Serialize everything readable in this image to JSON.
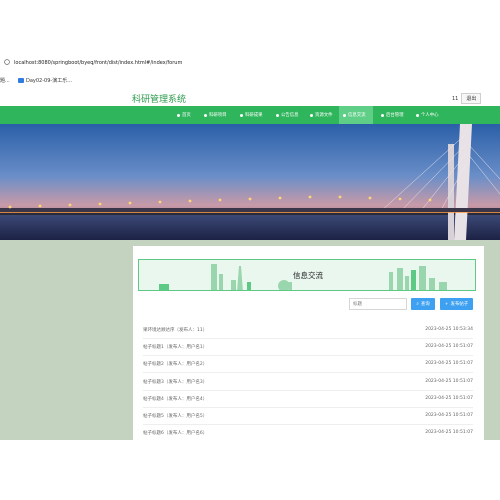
{
  "browser": {
    "url": "localhost:8080/springboot/byeq/front/dist/index.html#/index/forum",
    "bookmarks_left": "題...",
    "bookmark": "Day02-09-演工乐..."
  },
  "header": {
    "site_title": "科研管理系统",
    "user_count": "11",
    "exit_label": "退出"
  },
  "nav": {
    "items": [
      {
        "label": "首页"
      },
      {
        "label": "科研项目"
      },
      {
        "label": "科研成果"
      },
      {
        "label": "公告信息"
      },
      {
        "label": "资源文件"
      },
      {
        "label": "信息交流"
      },
      {
        "label": "后台管理"
      },
      {
        "label": "个人中心"
      }
    ],
    "active_index": 5
  },
  "forum": {
    "title": "信息交流",
    "search_placeholder": "标题",
    "search_label": "查询",
    "post_label": "发布帖子"
  },
  "posts": [
    {
      "title": "果环境达顾达序（发布人：11）",
      "date": "2023-04-25 10:53:34"
    },
    {
      "title": "帖子标题1（发布人：用户名1）",
      "date": "2023-04-25 10:51:07"
    },
    {
      "title": "帖子标题2（发布人：用户名2）",
      "date": "2023-04-25 10:51:07"
    },
    {
      "title": "帖子标题3（发布人：用户名3）",
      "date": "2023-04-25 10:51:07"
    },
    {
      "title": "帖子标题4（发布人：用户名4）",
      "date": "2023-04-25 10:51:07"
    },
    {
      "title": "帖子标题5（发布人：用户名5）",
      "date": "2023-04-25 10:51:07"
    },
    {
      "title": "帖子标题6（发布人：用户名6）",
      "date": "2023-04-25 10:51:07"
    }
  ],
  "colors": {
    "brand_green": "#2fb55b",
    "nav_active": "#5fcf88",
    "title_green": "#2a9a4c",
    "button_blue": "#3ea0f0",
    "page_background": "#c3d3bf"
  },
  "icons": {
    "nav": [
      "home-icon",
      "project-icon",
      "achievement-icon",
      "notice-icon",
      "file-icon",
      "forum-icon",
      "admin-icon",
      "user-icon"
    ],
    "search_button": "search-icon",
    "post_button": "plus-icon"
  }
}
